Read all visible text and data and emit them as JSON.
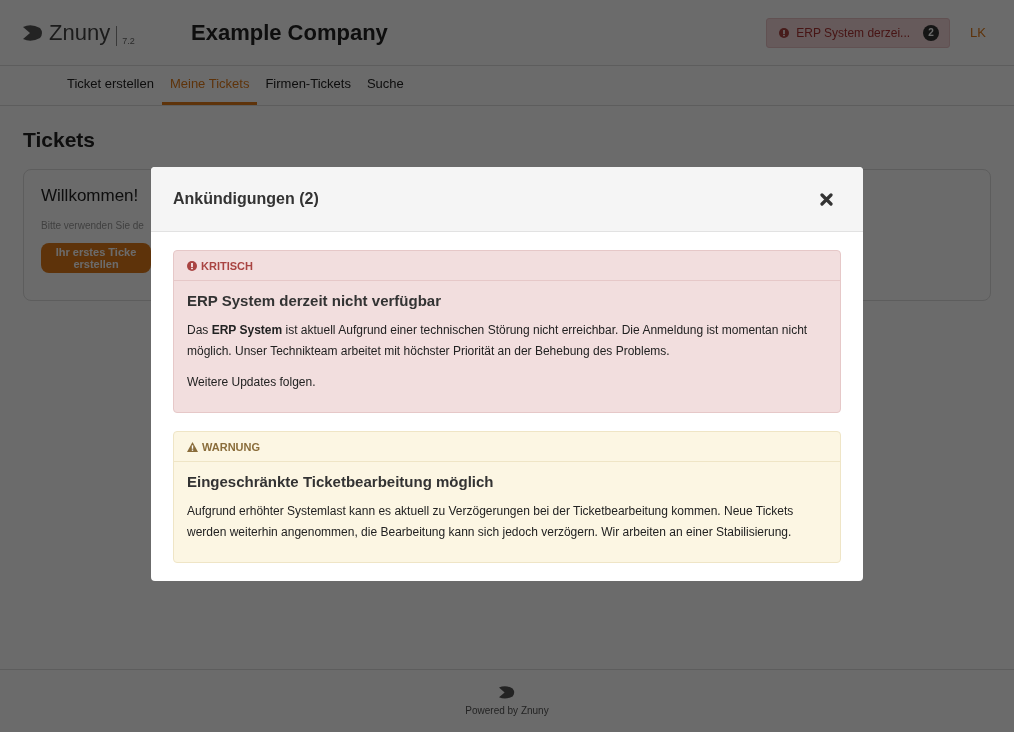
{
  "header": {
    "logo": "Znuny",
    "version": "7.2",
    "company": "Example Company",
    "alert": {
      "text": "ERP System derzei...",
      "count": "2"
    },
    "user": "LK"
  },
  "nav": [
    {
      "label": "Ticket erstellen",
      "selected": false
    },
    {
      "label": "Meine Tickets",
      "selected": true
    },
    {
      "label": "Firmen-Tickets",
      "selected": false
    },
    {
      "label": "Suche",
      "selected": false
    }
  ],
  "page_title": "Tickets",
  "welcome": {
    "title": "Willkommen!",
    "text": "Bitte verwenden Sie de",
    "button": "Ihr erstes Ticke erstellen"
  },
  "modal": {
    "title": "Ankündigungen (2)",
    "announcements": [
      {
        "kind": "critical",
        "label": "KRITISCH",
        "title": "ERP System derzeit nicht verfügbar",
        "paragraphs": [
          "Das **ERP System** ist aktuell Aufgrund einer technischen Störung nicht erreichbar. Die Anmeldung ist momentan nicht möglich. Unser Technikteam arbeitet mit höchster Priorität an der Behebung des Problems.",
          "Weitere Updates folgen."
        ]
      },
      {
        "kind": "warning",
        "label": "WARNUNG",
        "title": "Eingeschränkte Ticketbearbeitung möglich",
        "paragraphs": [
          "Aufgrund erhöhter Systemlast kann es aktuell zu Verzögerungen bei der Ticketbearbeitung kommen. Neue Tickets werden weiterhin angenommen, die Bearbeitung kann sich jedoch verzögern. Wir arbeiten an einer Stabilisierung."
        ]
      }
    ]
  },
  "footer": "Powered by Znuny"
}
